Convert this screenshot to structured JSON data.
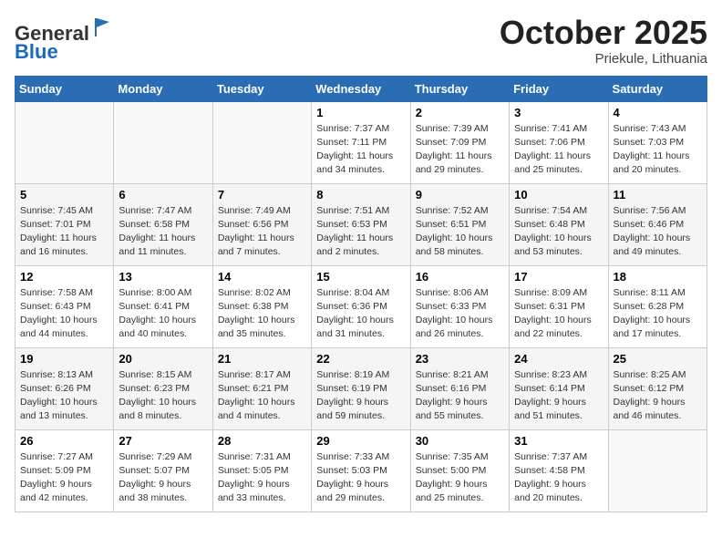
{
  "header": {
    "logo_general": "General",
    "logo_blue": "Blue",
    "month_title": "October 2025",
    "subtitle": "Priekule, Lithuania"
  },
  "weekdays": [
    "Sunday",
    "Monday",
    "Tuesday",
    "Wednesday",
    "Thursday",
    "Friday",
    "Saturday"
  ],
  "weeks": [
    [
      {
        "day": "",
        "info": ""
      },
      {
        "day": "",
        "info": ""
      },
      {
        "day": "",
        "info": ""
      },
      {
        "day": "1",
        "info": "Sunrise: 7:37 AM\nSunset: 7:11 PM\nDaylight: 11 hours\nand 34 minutes."
      },
      {
        "day": "2",
        "info": "Sunrise: 7:39 AM\nSunset: 7:09 PM\nDaylight: 11 hours\nand 29 minutes."
      },
      {
        "day": "3",
        "info": "Sunrise: 7:41 AM\nSunset: 7:06 PM\nDaylight: 11 hours\nand 25 minutes."
      },
      {
        "day": "4",
        "info": "Sunrise: 7:43 AM\nSunset: 7:03 PM\nDaylight: 11 hours\nand 20 minutes."
      }
    ],
    [
      {
        "day": "5",
        "info": "Sunrise: 7:45 AM\nSunset: 7:01 PM\nDaylight: 11 hours\nand 16 minutes."
      },
      {
        "day": "6",
        "info": "Sunrise: 7:47 AM\nSunset: 6:58 PM\nDaylight: 11 hours\nand 11 minutes."
      },
      {
        "day": "7",
        "info": "Sunrise: 7:49 AM\nSunset: 6:56 PM\nDaylight: 11 hours\nand 7 minutes."
      },
      {
        "day": "8",
        "info": "Sunrise: 7:51 AM\nSunset: 6:53 PM\nDaylight: 11 hours\nand 2 minutes."
      },
      {
        "day": "9",
        "info": "Sunrise: 7:52 AM\nSunset: 6:51 PM\nDaylight: 10 hours\nand 58 minutes."
      },
      {
        "day": "10",
        "info": "Sunrise: 7:54 AM\nSunset: 6:48 PM\nDaylight: 10 hours\nand 53 minutes."
      },
      {
        "day": "11",
        "info": "Sunrise: 7:56 AM\nSunset: 6:46 PM\nDaylight: 10 hours\nand 49 minutes."
      }
    ],
    [
      {
        "day": "12",
        "info": "Sunrise: 7:58 AM\nSunset: 6:43 PM\nDaylight: 10 hours\nand 44 minutes."
      },
      {
        "day": "13",
        "info": "Sunrise: 8:00 AM\nSunset: 6:41 PM\nDaylight: 10 hours\nand 40 minutes."
      },
      {
        "day": "14",
        "info": "Sunrise: 8:02 AM\nSunset: 6:38 PM\nDaylight: 10 hours\nand 35 minutes."
      },
      {
        "day": "15",
        "info": "Sunrise: 8:04 AM\nSunset: 6:36 PM\nDaylight: 10 hours\nand 31 minutes."
      },
      {
        "day": "16",
        "info": "Sunrise: 8:06 AM\nSunset: 6:33 PM\nDaylight: 10 hours\nand 26 minutes."
      },
      {
        "day": "17",
        "info": "Sunrise: 8:09 AM\nSunset: 6:31 PM\nDaylight: 10 hours\nand 22 minutes."
      },
      {
        "day": "18",
        "info": "Sunrise: 8:11 AM\nSunset: 6:28 PM\nDaylight: 10 hours\nand 17 minutes."
      }
    ],
    [
      {
        "day": "19",
        "info": "Sunrise: 8:13 AM\nSunset: 6:26 PM\nDaylight: 10 hours\nand 13 minutes."
      },
      {
        "day": "20",
        "info": "Sunrise: 8:15 AM\nSunset: 6:23 PM\nDaylight: 10 hours\nand 8 minutes."
      },
      {
        "day": "21",
        "info": "Sunrise: 8:17 AM\nSunset: 6:21 PM\nDaylight: 10 hours\nand 4 minutes."
      },
      {
        "day": "22",
        "info": "Sunrise: 8:19 AM\nSunset: 6:19 PM\nDaylight: 9 hours\nand 59 minutes."
      },
      {
        "day": "23",
        "info": "Sunrise: 8:21 AM\nSunset: 6:16 PM\nDaylight: 9 hours\nand 55 minutes."
      },
      {
        "day": "24",
        "info": "Sunrise: 8:23 AM\nSunset: 6:14 PM\nDaylight: 9 hours\nand 51 minutes."
      },
      {
        "day": "25",
        "info": "Sunrise: 8:25 AM\nSunset: 6:12 PM\nDaylight: 9 hours\nand 46 minutes."
      }
    ],
    [
      {
        "day": "26",
        "info": "Sunrise: 7:27 AM\nSunset: 5:09 PM\nDaylight: 9 hours\nand 42 minutes."
      },
      {
        "day": "27",
        "info": "Sunrise: 7:29 AM\nSunset: 5:07 PM\nDaylight: 9 hours\nand 38 minutes."
      },
      {
        "day": "28",
        "info": "Sunrise: 7:31 AM\nSunset: 5:05 PM\nDaylight: 9 hours\nand 33 minutes."
      },
      {
        "day": "29",
        "info": "Sunrise: 7:33 AM\nSunset: 5:03 PM\nDaylight: 9 hours\nand 29 minutes."
      },
      {
        "day": "30",
        "info": "Sunrise: 7:35 AM\nSunset: 5:00 PM\nDaylight: 9 hours\nand 25 minutes."
      },
      {
        "day": "31",
        "info": "Sunrise: 7:37 AM\nSunset: 4:58 PM\nDaylight: 9 hours\nand 20 minutes."
      },
      {
        "day": "",
        "info": ""
      }
    ]
  ]
}
